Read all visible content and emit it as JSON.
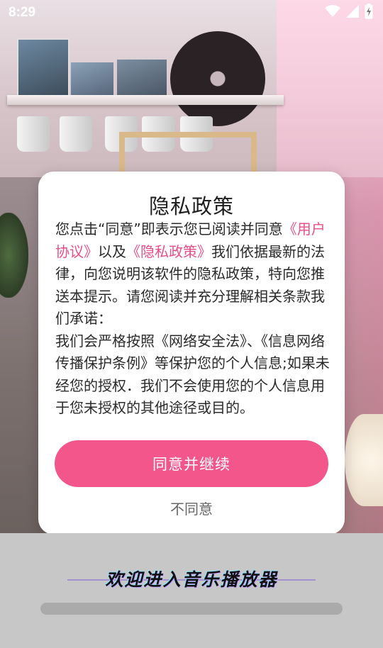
{
  "status_bar": {
    "time": "8:29",
    "icons": [
      "wifi-icon",
      "signal-icon",
      "battery-charging-icon"
    ]
  },
  "dialog": {
    "title": "隐私政策",
    "body": {
      "p1_part1": "您点击“同意”即表示您已阅读并同意",
      "p1_link1": "《用户协议》",
      "p1_part2": "以及",
      "p1_link2": "《隐私政策》",
      "p1_part3": "我们依据最新的法律，向您说明该软件的隐私政策，特向您推送本提示。请您阅读并充分理解相关条款我们承诺：",
      "p2": "我们会严格按照《网络安全法》、《信息网络传播保护条例》等保护您的个人信息;如果未经您的授权．我们不会使用您的个人信息用于您未授权的其他途径或目的。"
    },
    "agree_button": "同意并继续",
    "disagree_button": "不同意"
  },
  "welcome": {
    "text": "欢迎进入音乐播放器",
    "progress": 0
  },
  "colors": {
    "accent": "#f2568a",
    "link": "#e94e87",
    "bottom_background": "#c7c7c7"
  }
}
